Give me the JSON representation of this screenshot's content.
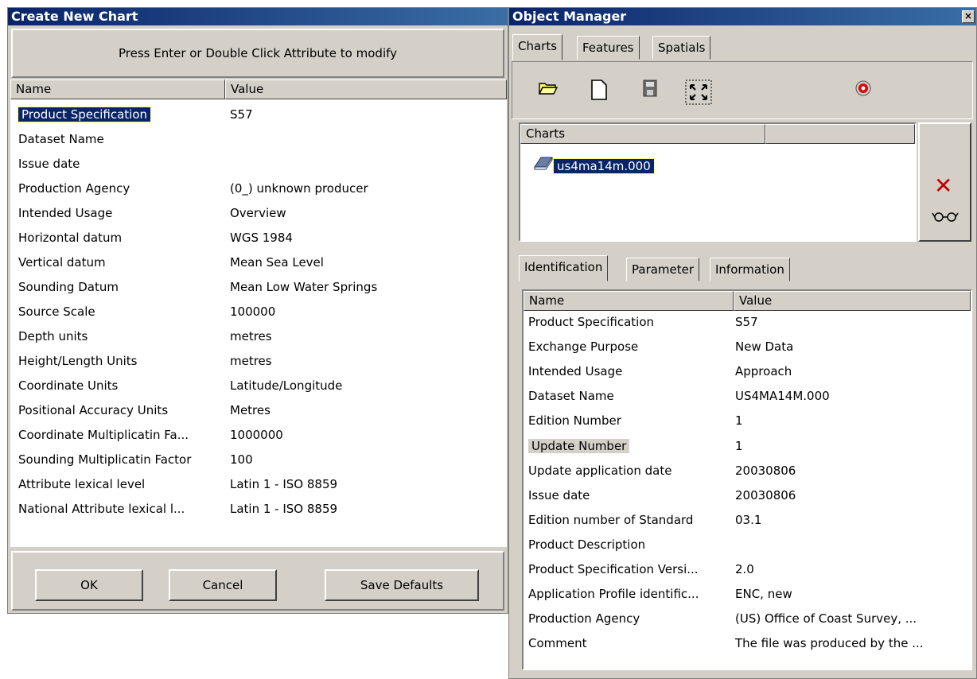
{
  "new_chart": {
    "title": "Create New Chart",
    "hint": "Press Enter or Double Click Attribute to modify",
    "columns": [
      "Name",
      "Value"
    ],
    "rows": [
      {
        "name": "Product Specification",
        "value": "S57",
        "selected": true
      },
      {
        "name": "Dataset Name",
        "value": ""
      },
      {
        "name": "Issue date",
        "value": ""
      },
      {
        "name": "Production Agency",
        "value": "(0_) unknown producer"
      },
      {
        "name": "Intended Usage",
        "value": "Overview"
      },
      {
        "name": "Horizontal datum",
        "value": "WGS 1984"
      },
      {
        "name": "Vertical datum",
        "value": "Mean Sea Level"
      },
      {
        "name": "Sounding Datum",
        "value": "Mean Low Water Springs"
      },
      {
        "name": "Source Scale",
        "value": "100000"
      },
      {
        "name": "Depth units",
        "value": "metres"
      },
      {
        "name": "Height/Length Units",
        "value": "metres"
      },
      {
        "name": "Coordinate Units",
        "value": "Latitude/Longitude"
      },
      {
        "name": "Positional Accuracy Units",
        "value": "Metres"
      },
      {
        "name": "Coordinate Multiplicatin Fa...",
        "value": "1000000"
      },
      {
        "name": "Sounding Multiplicatin Factor",
        "value": "100"
      },
      {
        "name": "Attribute lexical level",
        "value": "Latin 1 - ISO 8859"
      },
      {
        "name": "National Attribute lexical l...",
        "value": "Latin 1 - ISO 8859"
      }
    ],
    "buttons": {
      "ok": "OK",
      "cancel": "Cancel",
      "save_defaults": "Save Defaults"
    }
  },
  "object_manager": {
    "title": "Object Manager",
    "close_glyph": "×",
    "top_tabs": [
      "Charts",
      "Features",
      "Spatials"
    ],
    "charts_header": "Charts",
    "chart_items": [
      {
        "label": "us4ma14m.000",
        "selected": true
      }
    ],
    "bottom_tabs": [
      "Identification",
      "Parameter",
      "Information"
    ],
    "columns": [
      "Name",
      "Value"
    ],
    "rows": [
      {
        "name": "Product Specification",
        "value": "S57"
      },
      {
        "name": "Exchange Purpose",
        "value": "New Data"
      },
      {
        "name": "Intended Usage",
        "value": "Approach"
      },
      {
        "name": "Dataset Name",
        "value": "US4MA14M.000"
      },
      {
        "name": "Edition Number",
        "value": "1"
      },
      {
        "name": "Update Number",
        "value": "1",
        "highlighted": true
      },
      {
        "name": "Update application date",
        "value": "20030806"
      },
      {
        "name": "Issue date",
        "value": "20030806"
      },
      {
        "name": "Edition number of Standard",
        "value": "03.1"
      },
      {
        "name": "Product Description",
        "value": ""
      },
      {
        "name": "Product Specification Versi...",
        "value": "2.0"
      },
      {
        "name": "Application Profile identific...",
        "value": "ENC, new"
      },
      {
        "name": "Production Agency",
        "value": "(US) Office of Coast Survey, ..."
      },
      {
        "name": "Comment",
        "value": "The file was produced by the ..."
      }
    ],
    "icons": [
      "open-folder-icon",
      "new-file-icon",
      "save-icon",
      "fit-extent-icon",
      "record-icon",
      "delete-icon",
      "view-glasses-icon"
    ]
  }
}
